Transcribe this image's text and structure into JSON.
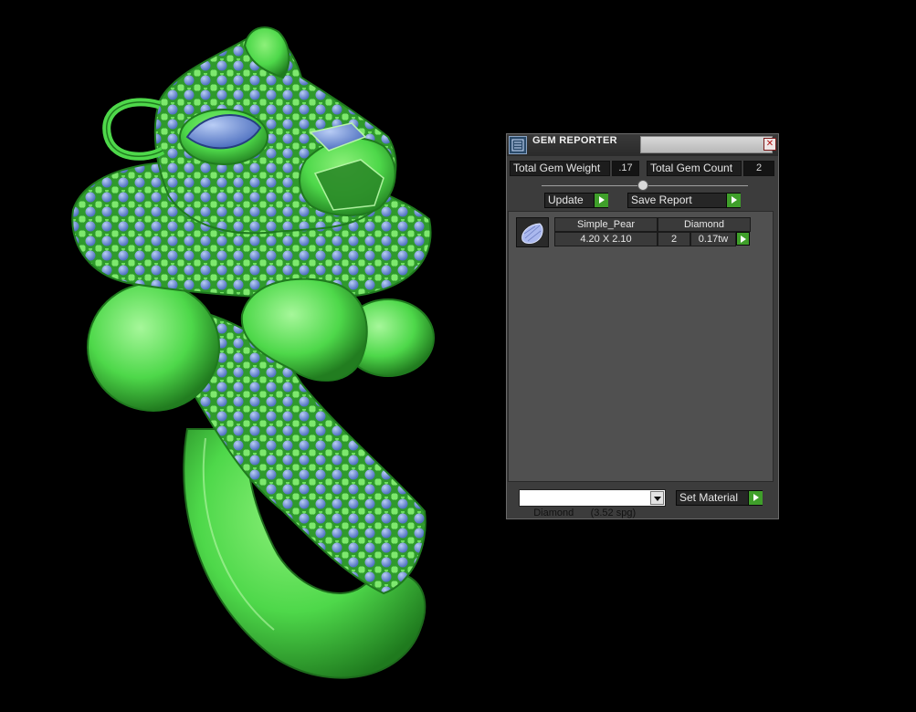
{
  "panel": {
    "title": "GEM REPORTER",
    "icon": "gem-report-icon",
    "total_gem_weight_label": "Total Gem Weight",
    "total_gem_weight_value": ".17",
    "total_gem_count_label": "Total Gem Count",
    "total_gem_count_value": "2",
    "update_label": "Update",
    "save_report_label": "Save Report",
    "results": [
      {
        "icon": "pear-gem-icon",
        "shape": "Simple_Pear",
        "material": "Diamond",
        "size": "4.20 X 2.10",
        "count": "2",
        "weight": "0.17tw"
      }
    ],
    "material_select_value": "Diamond      (3.52 spg)",
    "set_material_label": "Set Material"
  },
  "colors": {
    "model_green": "#4ed84a",
    "gem_blue": "#6f93d8",
    "accent_green": "#3f9f2a",
    "background": "#000000"
  }
}
